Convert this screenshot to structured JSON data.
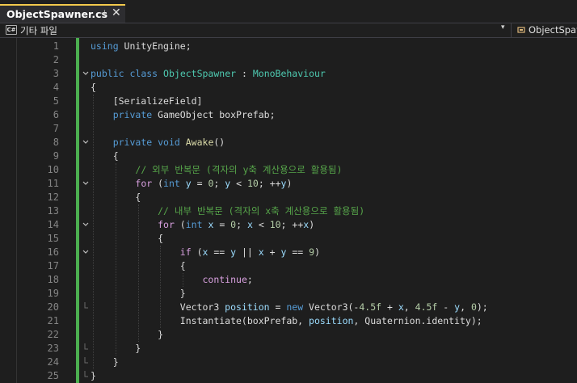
{
  "tab": {
    "title": "ObjectSpawner.cs",
    "pin": "⊣",
    "close": "✕"
  },
  "navbar": {
    "project_icon": "C#",
    "project": "기타 파일",
    "dropdown": "▾",
    "class_name": "ObjectSpawner"
  },
  "colors": {
    "change_bar": "#4caf50",
    "tab_accent": "#f2c94c",
    "keyword": "#569cd6",
    "comment": "#57a64a"
  },
  "lines": [
    {
      "n": "1",
      "fold": "",
      "tokens": [
        [
          "kw",
          "using"
        ],
        [
          "",
          " UnityEngine;"
        ]
      ]
    },
    {
      "n": "2",
      "fold": "",
      "tokens": []
    },
    {
      "n": "3",
      "fold": "open",
      "tokens": [
        [
          "kw",
          "public"
        ],
        [
          "",
          " "
        ],
        [
          "kw",
          "class"
        ],
        [
          "",
          " "
        ],
        [
          "ty",
          "ObjectSpawner"
        ],
        [
          "",
          " : "
        ],
        [
          "ty",
          "MonoBehaviour"
        ]
      ]
    },
    {
      "n": "4",
      "fold": "",
      "tokens": [
        [
          "",
          "{"
        ]
      ]
    },
    {
      "n": "5",
      "fold": "",
      "tokens": [
        [
          "",
          "    [SerializeField]"
        ]
      ]
    },
    {
      "n": "6",
      "fold": "",
      "tokens": [
        [
          "",
          "    "
        ],
        [
          "kw",
          "private"
        ],
        [
          "",
          " GameObject boxPrefab;"
        ]
      ]
    },
    {
      "n": "7",
      "fold": "",
      "tokens": []
    },
    {
      "n": "8",
      "fold": "open",
      "tokens": [
        [
          "",
          "    "
        ],
        [
          "kw",
          "private"
        ],
        [
          "",
          " "
        ],
        [
          "kw",
          "void"
        ],
        [
          "",
          " "
        ],
        [
          "fn",
          "Awake"
        ],
        [
          "",
          "()"
        ]
      ]
    },
    {
      "n": "9",
      "fold": "",
      "tokens": [
        [
          "",
          "    {"
        ]
      ]
    },
    {
      "n": "10",
      "fold": "",
      "tokens": [
        [
          "",
          "        "
        ],
        [
          "cm",
          "// 외부 반복문 (격자의 y축 계산용으로 활용됨)"
        ]
      ]
    },
    {
      "n": "11",
      "fold": "open",
      "tokens": [
        [
          "",
          "        "
        ],
        [
          "ctl",
          "for"
        ],
        [
          "",
          " ("
        ],
        [
          "kw",
          "int"
        ],
        [
          "",
          " "
        ],
        [
          "var",
          "y"
        ],
        [
          "",
          " = "
        ],
        [
          "num",
          "0"
        ],
        [
          "",
          "; "
        ],
        [
          "var",
          "y"
        ],
        [
          "",
          " < "
        ],
        [
          "num",
          "10"
        ],
        [
          "",
          "; ++"
        ],
        [
          "var",
          "y"
        ],
        [
          "",
          ")"
        ]
      ]
    },
    {
      "n": "12",
      "fold": "",
      "tokens": [
        [
          "",
          "        {"
        ]
      ]
    },
    {
      "n": "13",
      "fold": "",
      "tokens": [
        [
          "",
          "            "
        ],
        [
          "cm",
          "// 내부 반복문 (격자의 x축 계산용으로 활용됨)"
        ]
      ]
    },
    {
      "n": "14",
      "fold": "open",
      "tokens": [
        [
          "",
          "            "
        ],
        [
          "ctl",
          "for"
        ],
        [
          "",
          " ("
        ],
        [
          "kw",
          "int"
        ],
        [
          "",
          " "
        ],
        [
          "var",
          "x"
        ],
        [
          "",
          " = "
        ],
        [
          "num",
          "0"
        ],
        [
          "",
          "; "
        ],
        [
          "var",
          "x"
        ],
        [
          "",
          " < "
        ],
        [
          "num",
          "10"
        ],
        [
          "",
          "; ++"
        ],
        [
          "var",
          "x"
        ],
        [
          "",
          ")"
        ]
      ]
    },
    {
      "n": "15",
      "fold": "",
      "tokens": [
        [
          "",
          "            {"
        ]
      ]
    },
    {
      "n": "16",
      "fold": "open",
      "tokens": [
        [
          "",
          "                "
        ],
        [
          "ctl",
          "if"
        ],
        [
          "",
          " ("
        ],
        [
          "var",
          "x"
        ],
        [
          "",
          " == "
        ],
        [
          "var",
          "y"
        ],
        [
          "",
          " || "
        ],
        [
          "var",
          "x"
        ],
        [
          "",
          " + "
        ],
        [
          "var",
          "y"
        ],
        [
          "",
          " == "
        ],
        [
          "num",
          "9"
        ],
        [
          "",
          ")"
        ]
      ]
    },
    {
      "n": "17",
      "fold": "",
      "tokens": [
        [
          "",
          "                {"
        ]
      ]
    },
    {
      "n": "18",
      "fold": "",
      "tokens": [
        [
          "",
          "                    "
        ],
        [
          "ctl",
          "continue"
        ],
        [
          "",
          ";"
        ]
      ]
    },
    {
      "n": "19",
      "fold": "",
      "tokens": [
        [
          "",
          "                }"
        ]
      ]
    },
    {
      "n": "20",
      "fold": "end",
      "tokens": [
        [
          "",
          "                Vector3 "
        ],
        [
          "var",
          "position"
        ],
        [
          "",
          " = "
        ],
        [
          "kw",
          "new"
        ],
        [
          "",
          " Vector3(-"
        ],
        [
          "num",
          "4.5f"
        ],
        [
          "",
          " + "
        ],
        [
          "var",
          "x"
        ],
        [
          "",
          ", "
        ],
        [
          "num",
          "4.5f"
        ],
        [
          "",
          " - "
        ],
        [
          "var",
          "y"
        ],
        [
          "",
          ", "
        ],
        [
          "num",
          "0"
        ],
        [
          "",
          ");"
        ]
      ]
    },
    {
      "n": "21",
      "fold": "",
      "tokens": [
        [
          "",
          "                Instantiate(boxPrefab, "
        ],
        [
          "var",
          "position"
        ],
        [
          "",
          ", Quaternion.identity);"
        ]
      ]
    },
    {
      "n": "22",
      "fold": "",
      "tokens": [
        [
          "",
          "            }"
        ]
      ]
    },
    {
      "n": "23",
      "fold": "end",
      "tokens": [
        [
          "",
          "        }"
        ]
      ]
    },
    {
      "n": "24",
      "fold": "end",
      "tokens": [
        [
          "",
          "    }"
        ]
      ]
    },
    {
      "n": "25",
      "fold": "end",
      "tokens": [
        [
          "",
          "}"
        ]
      ]
    }
  ]
}
